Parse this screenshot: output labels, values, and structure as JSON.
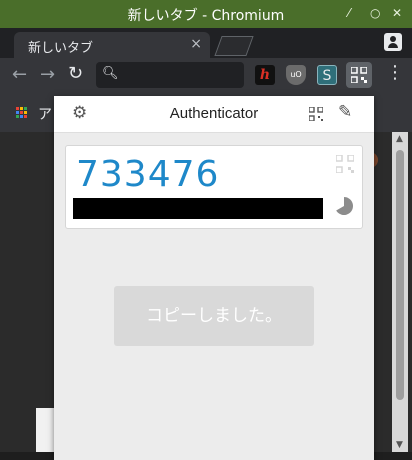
{
  "window": {
    "title": "新しいタブ - Chromium"
  },
  "tab": {
    "title": "新しいタブ",
    "close_glyph": "×"
  },
  "bookmarks": {
    "partial_text": "ア"
  },
  "popup": {
    "title": "Authenticator",
    "entry": {
      "code": "733476"
    },
    "copied_message": "コピーしました。"
  }
}
